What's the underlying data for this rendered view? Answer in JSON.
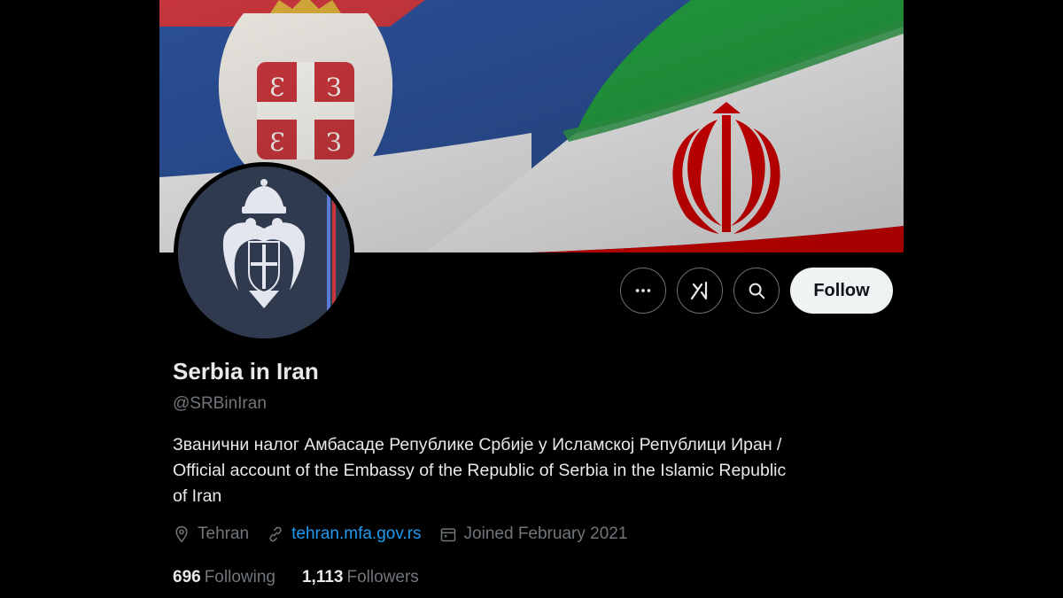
{
  "profile": {
    "display_name": "Serbia in Iran",
    "handle": "@SRBinIran",
    "bio_lines": [
      "Званични налог Амбасаде Републике Србије у Исламској Републици Иран /",
      "Official account of the Embassy of the Republic of Serbia in the Islamic Republic",
      "of Iran"
    ],
    "location": "Tehran",
    "website": "tehran.mfa.gov.rs",
    "joined": "Joined February 2021",
    "following_count": "696",
    "following_label": "Following",
    "followers_count": "1,113",
    "followers_label": "Followers"
  },
  "actions": {
    "more_icon": "more-icon",
    "grok_icon": "grok-icon",
    "search_icon": "search-icon",
    "follow_label": "Follow"
  },
  "colors": {
    "background": "#000000",
    "text_primary": "#e7e9ea",
    "text_secondary": "#71767b",
    "link": "#1d9bf0",
    "follow_button_bg": "#eff3f4",
    "serbia_red": "#c6363c",
    "serbia_blue": "#2b4f96",
    "iran_green": "#239f40",
    "iran_red": "#da0000"
  }
}
